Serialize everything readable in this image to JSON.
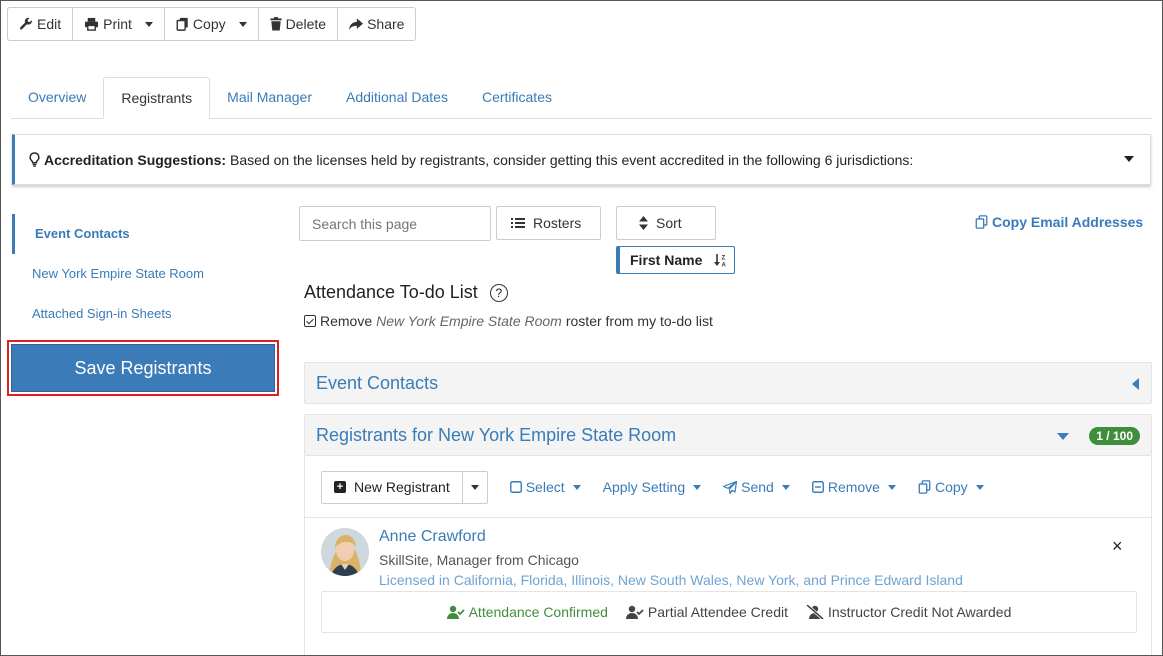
{
  "toolbar": {
    "edit": "Edit",
    "print": "Print",
    "copy": "Copy",
    "delete": "Delete",
    "share": "Share"
  },
  "tabs": [
    {
      "label": "Overview"
    },
    {
      "label": "Registrants"
    },
    {
      "label": "Mail Manager"
    },
    {
      "label": "Additional Dates"
    },
    {
      "label": "Certificates"
    }
  ],
  "active_tab": "Registrants",
  "suggestion": {
    "title": "Accreditation Suggestions:",
    "text": "Based on the licenses held by registrants, consider getting this event accredited in the following 6 jurisdictions:"
  },
  "leftnav": {
    "items": [
      {
        "label": "Event Contacts"
      },
      {
        "label": "New York Empire State Room"
      },
      {
        "label": "Attached Sign-in Sheets"
      }
    ],
    "save_label": "Save Registrants"
  },
  "search": {
    "placeholder": "Search this page"
  },
  "rosters_label": "Rosters",
  "sort_label": "Sort",
  "sort_field": "First Name",
  "copy_email_label": "Copy Email Addresses",
  "todo": {
    "title": "Attendance To-do List",
    "help": "?",
    "item_prefix": "Remove",
    "item_room": "New York Empire State Room",
    "item_suffix": "roster from my to-do list"
  },
  "panels": {
    "event_contacts": "Event Contacts",
    "registrants": "Registrants for New York Empire State Room",
    "count_badge": "1 / 100"
  },
  "actions": {
    "new_registrant": "New Registrant",
    "select": "Select",
    "apply_setting": "Apply Setting",
    "send": "Send",
    "remove": "Remove",
    "copy": "Copy"
  },
  "registrant": {
    "name": "Anne Crawford",
    "subtitle": "SkillSite, Manager from Chicago",
    "licensed": "Licensed in California, Florida, Illinois, New South Wales, New York, and Prince Edward Island",
    "close": "×",
    "statuses": [
      {
        "label": "Attendance Confirmed"
      },
      {
        "label": "Partial Attendee Credit"
      },
      {
        "label": "Instructor Credit Not Awarded"
      }
    ]
  },
  "colors": {
    "accent": "#3a7bb8",
    "success": "#3e8e3e",
    "highlight_border": "#e02020"
  }
}
